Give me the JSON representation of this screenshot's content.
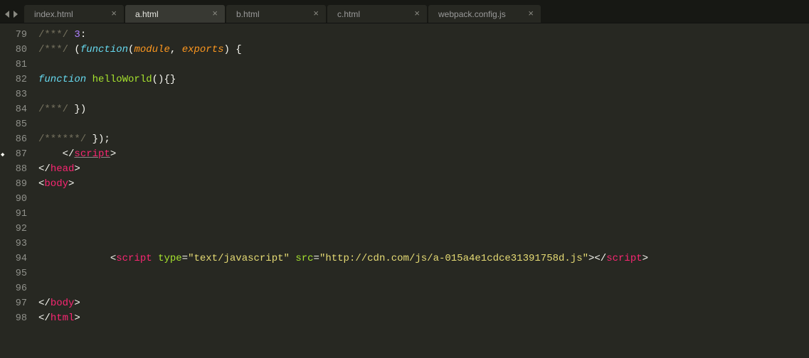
{
  "tabs": [
    {
      "label": "index.html",
      "active": false
    },
    {
      "label": "a.html",
      "active": true
    },
    {
      "label": "b.html",
      "active": false
    },
    {
      "label": "c.html",
      "active": false
    },
    {
      "label": "webpack.config.js",
      "active": false
    }
  ],
  "gutterStart": 79,
  "gutterEnd": 98,
  "markLine": 87,
  "code": {
    "l79": {
      "cm": "/***/ ",
      "num": "3",
      "colon": ":"
    },
    "l80": {
      "cm": "/***/ ",
      "p1": "(",
      "kw": "function",
      "p2": "(",
      "a1": "module",
      "comma": ", ",
      "a2": "exports",
      "p3": ") {"
    },
    "l82": {
      "kw": "function",
      "sp": " ",
      "fn": "helloWorld",
      "rest": "(){}"
    },
    "l84": {
      "cm": "/***/ ",
      "rest": "})"
    },
    "l86": {
      "cm": "/******/ ",
      "rest": "});"
    },
    "l87": {
      "lt": "</",
      "tag": "script",
      "gt": ">"
    },
    "l88": {
      "lt": "</",
      "tag": "head",
      "gt": ">"
    },
    "l89": {
      "lt": "<",
      "tag": "body",
      "gt": ">"
    },
    "l94": {
      "lt": "<",
      "tag": "script",
      "sp": " ",
      "attr1": "type",
      "eq1": "=",
      "str1": "\"text/javascript\"",
      "sp2": " ",
      "attr2": "src",
      "eq2": "=",
      "str2": "\"http://cdn.com/js/a-015a4e1cdce31391758d.js\"",
      "gt": ">",
      "lt2": "</",
      "tag2": "script",
      "gt2": ">"
    },
    "l97": {
      "lt": "</",
      "tag": "body",
      "gt": ">"
    },
    "l98": {
      "lt": "</",
      "tag": "html",
      "gt": ">"
    }
  }
}
